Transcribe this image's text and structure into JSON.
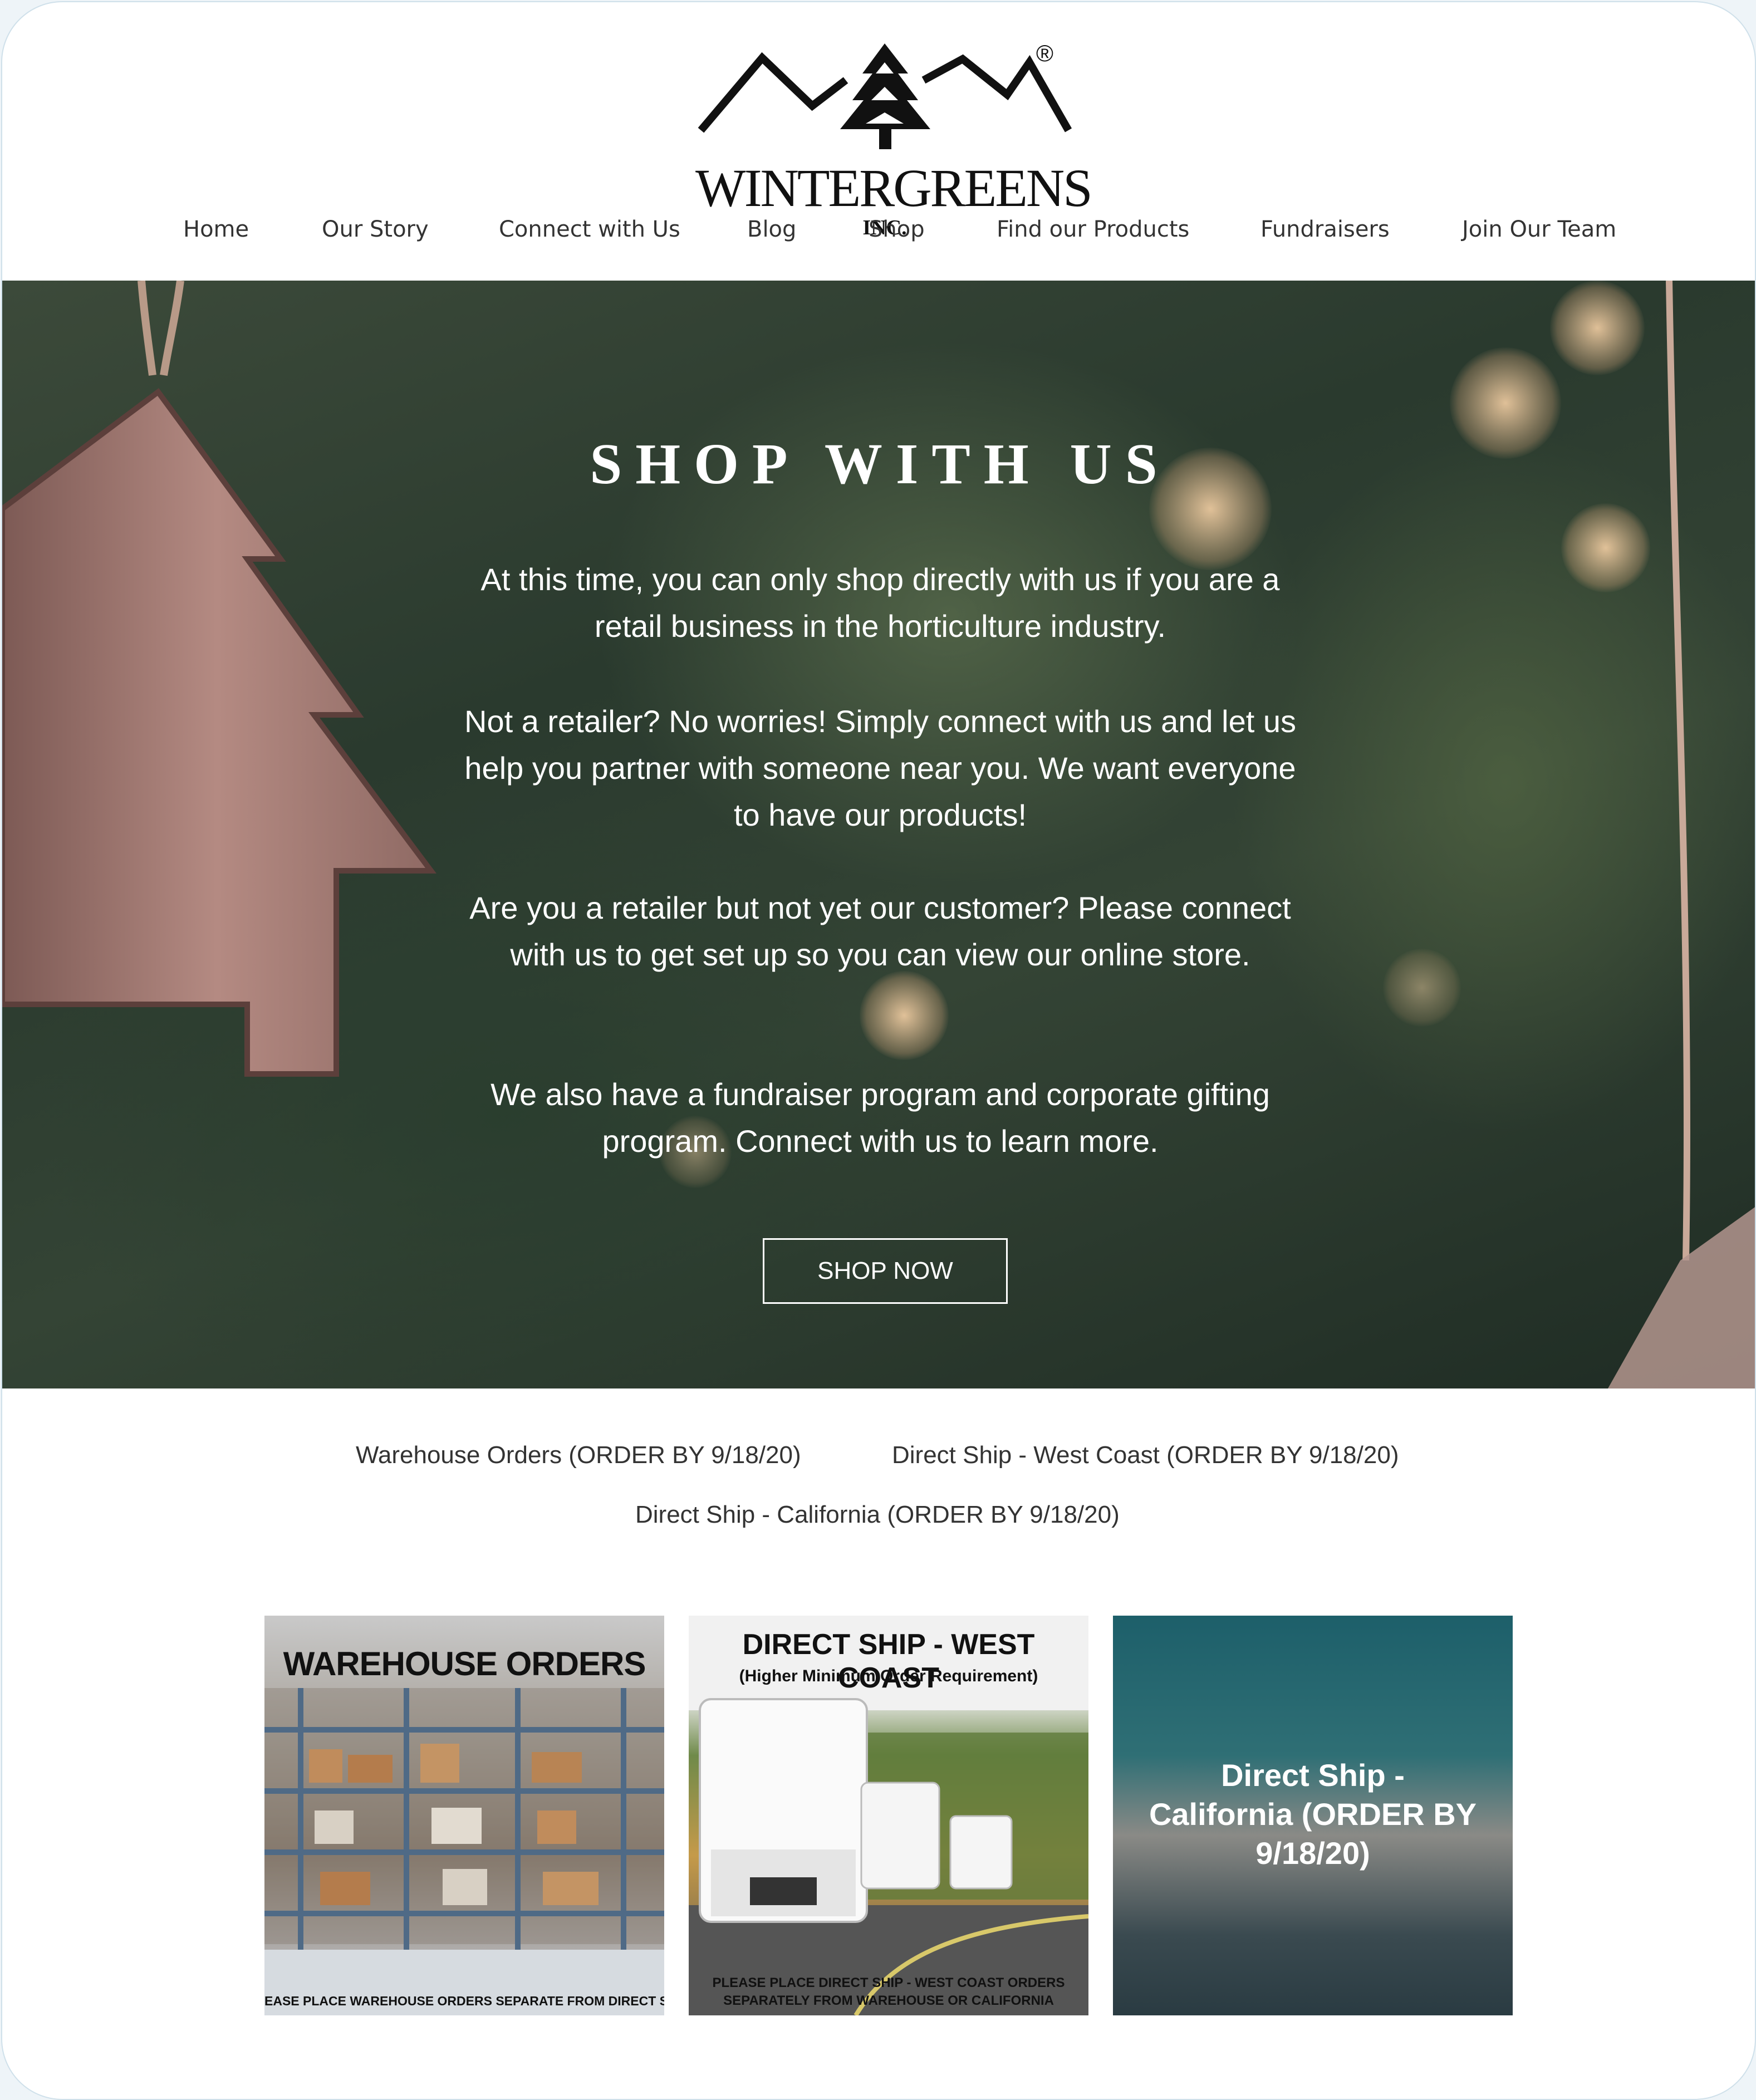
{
  "brand": {
    "name": "WINTERGREENS",
    "suffix": "INC.",
    "registered": "®"
  },
  "nav": {
    "items": [
      {
        "label": "Home"
      },
      {
        "label": "Our Story"
      },
      {
        "label": "Connect with Us"
      },
      {
        "label": "Blog"
      },
      {
        "label": "Shop"
      },
      {
        "label": "Find our Products"
      },
      {
        "label": "Fundraisers"
      },
      {
        "label": "Join Our Team"
      }
    ]
  },
  "hero": {
    "title": "SHOP WITH US",
    "paragraphs": [
      "At this time, you can only shop directly with us if you are a retail business in the horticulture industry.",
      "Not a retailer? No worries! Simply connect with us and let us help you partner with someone near you. We want everyone to have our products!",
      "Are you a retailer but not yet our customer? Please connect with us to get set up so you can view our online store.",
      "We also have  a fundraiser program and corporate gifting program. Connect with us to learn more."
    ],
    "button_label": "SHOP NOW"
  },
  "categories": {
    "links": [
      "Warehouse Orders (ORDER BY 9/18/20)",
      "Direct Ship - West Coast (ORDER BY 9/18/20)",
      "Direct Ship - California (ORDER BY 9/18/20)"
    ],
    "tiles": [
      {
        "title": "WAREHOUSE ORDERS",
        "footer": "EASE PLACE WAREHOUSE ORDERS SEPARATE FROM DIRECT SHI"
      },
      {
        "title": "DIRECT SHIP - WEST COAST",
        "subtitle": "(Higher Minimum Order Requirement)",
        "footer": "PLEASE PLACE DIRECT SHIP - WEST COAST ORDERS SEPARATELY FROM WAREHOUSE OR CALIFORNIA"
      },
      {
        "title": "Direct Ship - California (ORDER BY 9/18/20)"
      }
    ]
  },
  "colors": {
    "text": "#333333",
    "hero_text": "#ffffff",
    "accent_border": "#cfe0ea"
  }
}
